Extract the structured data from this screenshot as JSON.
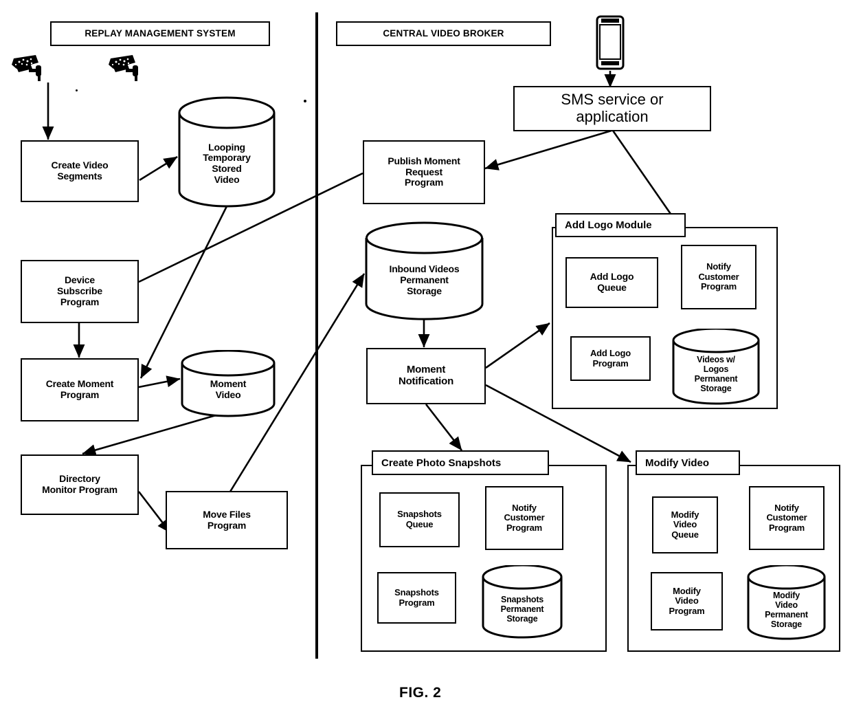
{
  "figure": {
    "caption": "FIG. 2"
  },
  "banners": {
    "left": "REPLAY MANAGEMENT SYSTEM",
    "right": "CENTRAL VIDEO BROKER"
  },
  "icons": {
    "camera_1": "security-camera-icon",
    "camera_2": "security-camera-icon",
    "phone": "mobile-phone-icon"
  },
  "left_system": {
    "nodes": [
      {
        "id": "create-video-segments",
        "label": "Create Video\nSegments",
        "shape": "process"
      },
      {
        "id": "looping-temporary-stored-video",
        "label": "Looping\nTemporary\nStored\nVideo",
        "shape": "datastore"
      },
      {
        "id": "device-subscribe-program",
        "label": "Device\nSubscribe\nProgram",
        "shape": "process"
      },
      {
        "id": "create-moment-program",
        "label": "Create Moment\nProgram",
        "shape": "process"
      },
      {
        "id": "moment-video",
        "label": "Moment\nVideo",
        "shape": "datastore"
      },
      {
        "id": "directory-monitor-program",
        "label": "Directory\nMonitor Program",
        "shape": "process"
      },
      {
        "id": "move-files-program",
        "label": "Move Files\nProgram",
        "shape": "process"
      }
    ]
  },
  "right_system": {
    "nodes": [
      {
        "id": "sms-service-or-application",
        "label": "SMS service or\napplication",
        "shape": "process"
      },
      {
        "id": "publish-moment-request-program",
        "label": "Publish Moment\nRequest\nProgram",
        "shape": "process"
      },
      {
        "id": "inbound-videos-permanent-storage",
        "label": "Inbound Videos\nPermanent\nStorage",
        "shape": "datastore"
      },
      {
        "id": "moment-notification",
        "label": "Moment\nNotification",
        "shape": "process"
      }
    ],
    "modules": [
      {
        "id": "add-logo-module",
        "title": "Add Logo Module",
        "nodes": [
          {
            "id": "add-logo-queue",
            "label": "Add Logo\nQueue",
            "shape": "process"
          },
          {
            "id": "add-logo-notify-customer-program",
            "label": "Notify\nCustomer\nProgram",
            "shape": "process"
          },
          {
            "id": "add-logo-program",
            "label": "Add Logo\nProgram",
            "shape": "process"
          },
          {
            "id": "videos-w-logos-permanent-storage",
            "label": "Videos w/\nLogos\nPermanent\nStorage",
            "shape": "datastore"
          }
        ]
      },
      {
        "id": "create-photo-snapshots",
        "title": "Create Photo Snapshots",
        "nodes": [
          {
            "id": "snapshots-queue",
            "label": "Snapshots\nQueue",
            "shape": "process"
          },
          {
            "id": "snapshots-notify-customer-program",
            "label": "Notify\nCustomer\nProgram",
            "shape": "process"
          },
          {
            "id": "snapshots-program",
            "label": "Snapshots\nProgram",
            "shape": "process"
          },
          {
            "id": "snapshots-permanent-storage",
            "label": "Snapshots\nPermanent\nStorage",
            "shape": "datastore"
          }
        ]
      },
      {
        "id": "modify-video",
        "title": "Modify Video",
        "nodes": [
          {
            "id": "modify-video-queue",
            "label": "Modify\nVideo\nQueue",
            "shape": "process"
          },
          {
            "id": "modify-video-notify-customer-program",
            "label": "Notify\nCustomer\nProgram",
            "shape": "process"
          },
          {
            "id": "modify-video-program",
            "label": "Modify\nVideo\nProgram",
            "shape": "process"
          },
          {
            "id": "modify-video-permanent-storage",
            "label": "Modify\nVideo\nPermanent\nStorage",
            "shape": "datastore"
          }
        ]
      }
    ]
  },
  "connections": [
    {
      "from": "cameras",
      "to": "create-video-segments",
      "arrow": true
    },
    {
      "from": "create-video-segments",
      "to": "looping-temporary-stored-video",
      "arrow": true
    },
    {
      "from": "looping-temporary-stored-video",
      "to": "create-moment-program",
      "arrow": true
    },
    {
      "from": "device-subscribe-program",
      "to": "create-moment-program",
      "arrow": true
    },
    {
      "from": "device-subscribe-program",
      "to": "publish-moment-request-program",
      "arrow": false
    },
    {
      "from": "create-moment-program",
      "to": "moment-video",
      "arrow": true
    },
    {
      "from": "moment-video",
      "to": "directory-monitor-program",
      "arrow": true
    },
    {
      "from": "directory-monitor-program",
      "to": "move-files-program",
      "arrow": true
    },
    {
      "from": "move-files-program",
      "to": "inbound-videos-permanent-storage",
      "arrow": true
    },
    {
      "from": "phone",
      "to": "sms-service-or-application",
      "arrow": true
    },
    {
      "from": "sms-service-or-application",
      "to": "publish-moment-request-program",
      "arrow": true
    },
    {
      "from": "sms-service-or-application",
      "to": "add-logo-notify-customer-program",
      "arrow": false
    },
    {
      "from": "inbound-videos-permanent-storage",
      "to": "moment-notification",
      "arrow": true
    },
    {
      "from": "moment-notification",
      "to": "add-logo-module",
      "arrow": true
    },
    {
      "from": "moment-notification",
      "to": "create-photo-snapshots",
      "arrow": true
    },
    {
      "from": "moment-notification",
      "to": "modify-video",
      "arrow": true
    },
    {
      "from": "add-logo-queue",
      "to": "add-logo-program",
      "arrow": true
    },
    {
      "from": "add-logo-program",
      "to": "videos-w-logos-permanent-storage",
      "arrow": true
    },
    {
      "from": "videos-w-logos-permanent-storage",
      "to": "add-logo-notify-customer-program",
      "arrow": true
    },
    {
      "from": "snapshots-queue",
      "to": "snapshots-program",
      "arrow": true
    },
    {
      "from": "snapshots-program",
      "to": "snapshots-permanent-storage",
      "arrow": true
    },
    {
      "from": "snapshots-permanent-storage",
      "to": "snapshots-notify-customer-program",
      "arrow": true
    },
    {
      "from": "modify-video-queue",
      "to": "modify-video-program",
      "arrow": true
    },
    {
      "from": "modify-video-program",
      "to": "modify-video-permanent-storage",
      "arrow": true
    },
    {
      "from": "modify-video-permanent-storage",
      "to": "modify-video-notify-customer-program",
      "arrow": true
    }
  ],
  "colors": {
    "ink": "#000000",
    "paper": "#ffffff"
  }
}
